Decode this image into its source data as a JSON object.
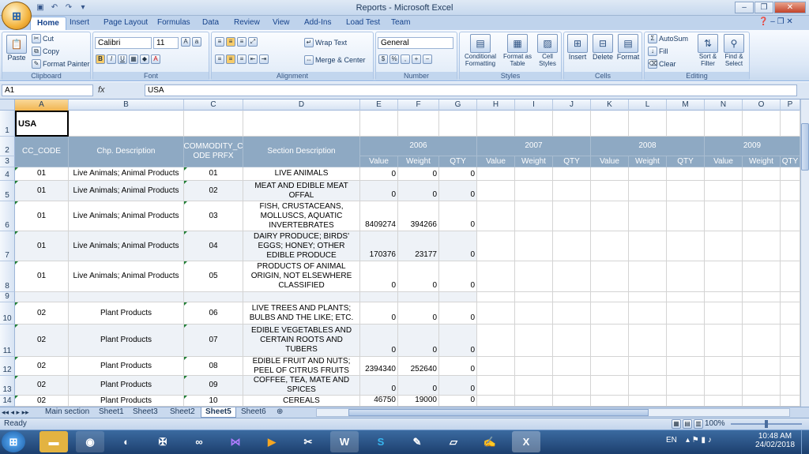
{
  "window": {
    "title": "Reports - Microsoft Excel"
  },
  "ribbon": {
    "tabs": [
      "Home",
      "Insert",
      "Page Layout",
      "Formulas",
      "Data",
      "Review",
      "View",
      "Add-Ins",
      "Load Test",
      "Team"
    ],
    "clipboard": {
      "label": "Clipboard",
      "paste": "Paste",
      "cut": "Cut",
      "copy": "Copy",
      "format_painter": "Format Painter"
    },
    "font": {
      "label": "Font",
      "name": "Calibri",
      "size": "11"
    },
    "alignment": {
      "label": "Alignment",
      "wrap_text": "Wrap Text",
      "merge_center": "Merge & Center"
    },
    "number": {
      "label": "Number",
      "format": "General"
    },
    "styles": {
      "label": "Styles",
      "conditional": "Conditional Formatting",
      "format_table": "Format as Table",
      "cell_styles": "Cell Styles"
    },
    "cells": {
      "label": "Cells",
      "insert": "Insert",
      "delete": "Delete",
      "format": "Format"
    },
    "editing": {
      "label": "Editing",
      "autosum": "AutoSum",
      "fill": "Fill",
      "clear": "Clear",
      "sort": "Sort & Filter",
      "find": "Find & Select"
    }
  },
  "formula_bar": {
    "name_box": "A1",
    "fx": "fx",
    "content": "USA"
  },
  "columns": [
    "A",
    "B",
    "C",
    "D",
    "E",
    "F",
    "G",
    "H",
    "I",
    "J",
    "K",
    "L",
    "M",
    "N",
    "O",
    "P"
  ],
  "sheet": {
    "a1": "USA",
    "headers": {
      "cc_code": "CC_CODE",
      "chp_desc": "Chp. Description",
      "commodity": "COMMODITY_C ODE PRFX",
      "section": "Section Description",
      "years": [
        "2006",
        "2007",
        "2008",
        "2009"
      ],
      "sub": [
        "Value",
        "Weight",
        "QTY",
        "Value",
        "Weight",
        "QTY",
        "Value",
        "Weight",
        "QTY",
        "Value",
        "Weight",
        "QTY"
      ]
    },
    "rows": [
      {
        "row": "4",
        "cc": "01",
        "chp": "Live Animals; Animal Products",
        "code": "01",
        "section": "LIVE ANIMALS",
        "value": "0",
        "weight": "0",
        "qty": "0"
      },
      {
        "row": "5",
        "cc": "01",
        "chp": "Live Animals; Animal Products",
        "code": "02",
        "section": "MEAT AND EDIBLE MEAT OFFAL",
        "value": "0",
        "weight": "0",
        "qty": "0"
      },
      {
        "row": "6",
        "cc": "01",
        "chp": "Live Animals; Animal Products",
        "code": "03",
        "section": "FISH, CRUSTACEANS, MOLLUSCS, AQUATIC INVERTEBRATES",
        "value": "8409274",
        "weight": "394266",
        "qty": "0"
      },
      {
        "row": "7",
        "cc": "01",
        "chp": "Live Animals; Animal Products",
        "code": "04",
        "section": "DAIRY PRODUCE; BIRDS' EGGS; HONEY; OTHER EDIBLE PRODUCE",
        "value": "170376",
        "weight": "23177",
        "qty": "0"
      },
      {
        "row": "8",
        "cc": "01",
        "chp": "Live Animals; Animal Products",
        "code": "05",
        "section": "PRODUCTS OF ANIMAL ORIGIN, NOT ELSEWHERE CLASSIFIED",
        "value": "0",
        "weight": "0",
        "qty": "0"
      },
      {
        "row": "9",
        "cc": "",
        "chp": "",
        "code": "",
        "section": "",
        "value": "",
        "weight": "",
        "qty": ""
      },
      {
        "row": "10",
        "cc": "02",
        "chp": "Plant Products",
        "code": "06",
        "section": "LIVE TREES AND PLANTS; BULBS AND THE LIKE; ETC.",
        "value": "0",
        "weight": "0",
        "qty": "0"
      },
      {
        "row": "11",
        "cc": "02",
        "chp": "Plant Products",
        "code": "07",
        "section": "EDIBLE VEGETABLES AND CERTAIN ROOTS AND TUBERS",
        "value": "0",
        "weight": "0",
        "qty": "0"
      },
      {
        "row": "12",
        "cc": "02",
        "chp": "Plant Products",
        "code": "08",
        "section": "EDIBLE FRUIT AND NUTS; PEEL OF CITRUS FRUITS",
        "value": "2394340",
        "weight": "252640",
        "qty": "0"
      },
      {
        "row": "13",
        "cc": "02",
        "chp": "Plant Products",
        "code": "09",
        "section": "COFFEE, TEA, MATE AND SPICES",
        "value": "0",
        "weight": "0",
        "qty": "0"
      },
      {
        "row": "14",
        "cc": "02",
        "chp": "Plant Products",
        "code": "10",
        "section": "CEREALS",
        "value": "46750",
        "weight": "19000",
        "qty": "0"
      }
    ]
  },
  "sheet_tabs": [
    "Main section",
    "Sheet1",
    "Sheet3",
    "Sheet2",
    "Sheet5",
    "Sheet6"
  ],
  "active_sheet": "Sheet5",
  "status": {
    "ready": "Ready",
    "zoom": "100%"
  },
  "taskbar": {
    "lang": "EN",
    "time": "10:48 AM",
    "date": "24/02/2018"
  },
  "colors": {
    "header_fill": "#8ea9c3",
    "ribbon": "#dbe7f6",
    "taskbar": "#1c3f6e"
  }
}
